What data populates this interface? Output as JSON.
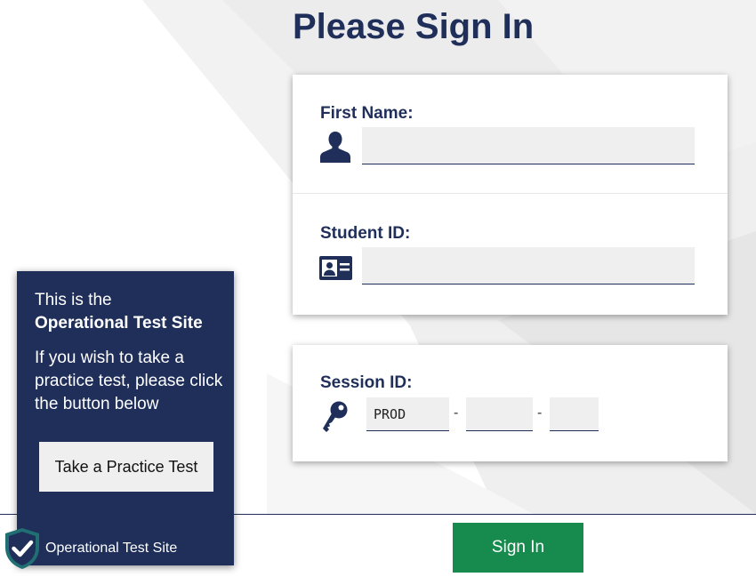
{
  "page": {
    "title": "Please Sign In"
  },
  "form": {
    "first_name": {
      "label": "First Name:",
      "value": "",
      "icon": "person-icon"
    },
    "student_id": {
      "label": "Student ID:",
      "value": "",
      "icon": "id-card-icon"
    }
  },
  "session": {
    "label": "Session ID:",
    "icon": "key-icon",
    "part1": "PROD",
    "part2": "",
    "part3": "",
    "separator": "-"
  },
  "info_panel": {
    "line1": "This is the",
    "line2": "Operational Test Site",
    "description": "If you wish to take a practice test, please click the button below",
    "practice_button_label": "Take a Practice Test"
  },
  "footer": {
    "site_label": "Operational Test Site",
    "badge_icon": "shield-check-icon",
    "signin_label": "Sign In"
  },
  "colors": {
    "primary_navy": "#1f2f5a",
    "signin_green": "#178a4d",
    "badge_teal": "#1f6f73",
    "input_background": "#efefef"
  }
}
